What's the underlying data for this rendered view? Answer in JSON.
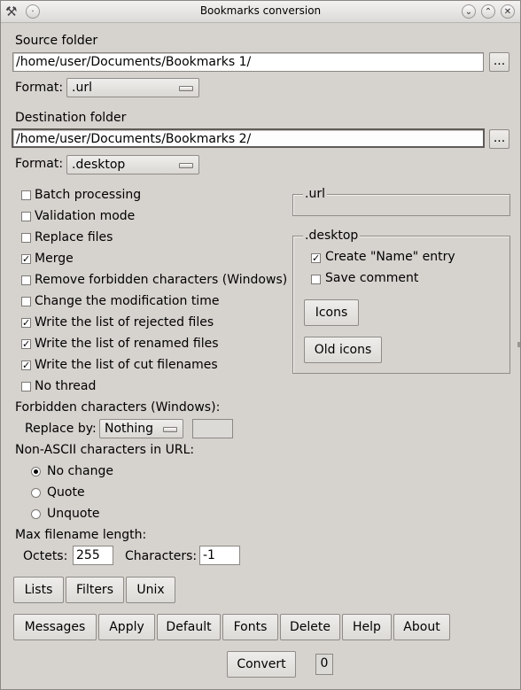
{
  "window": {
    "title": "Bookmarks conversion"
  },
  "source": {
    "heading": "Source folder",
    "path": "/home/user/Documents/Bookmarks 1/",
    "browse_label": "...",
    "format_label": "Format:",
    "format_value": ".url"
  },
  "destination": {
    "heading": "Destination folder",
    "path": "/home/user/Documents/Bookmarks 2/",
    "browse_label": "...",
    "format_label": "Format:",
    "format_value": ".desktop"
  },
  "options": [
    {
      "label": "Batch processing",
      "checked": false
    },
    {
      "label": "Validation mode",
      "checked": false
    },
    {
      "label": "Replace files",
      "checked": false
    },
    {
      "label": "Merge",
      "checked": true
    },
    {
      "label": "Remove forbidden characters (Windows)",
      "checked": false
    },
    {
      "label": "Change the modification time",
      "checked": false
    },
    {
      "label": "Write the list of rejected files",
      "checked": true
    },
    {
      "label": "Write the list of renamed files",
      "checked": true
    },
    {
      "label": "Write the list of cut filenames",
      "checked": true
    },
    {
      "label": "No thread",
      "checked": false
    }
  ],
  "url_group": {
    "title": ".url"
  },
  "desktop_group": {
    "title": ".desktop",
    "create_name": {
      "label": "Create \"Name\" entry",
      "checked": true
    },
    "save_comment": {
      "label": "Save comment",
      "checked": false
    },
    "icons_label": "Icons",
    "old_icons_label": "Old icons"
  },
  "forbidden": {
    "heading": "Forbidden characters (Windows):",
    "replace_label": "Replace by:",
    "replace_value": "Nothing",
    "replace_char": ""
  },
  "nonascii": {
    "heading": "Non-ASCII characters in URL:",
    "options": [
      {
        "label": "No change",
        "selected": true
      },
      {
        "label": "Quote",
        "selected": false
      },
      {
        "label": "Unquote",
        "selected": false
      }
    ]
  },
  "maxlen": {
    "heading": "Max filename length:",
    "octets_label": "Octets:",
    "octets_value": "255",
    "chars_label": "Characters:",
    "chars_value": "-1"
  },
  "tabs": [
    "Lists",
    "Filters",
    "Unix"
  ],
  "bottom_buttons": [
    "Messages",
    "Apply",
    "Default",
    "Fonts",
    "Delete",
    "Help",
    "About"
  ],
  "convert": {
    "label": "Convert",
    "count": "0"
  }
}
